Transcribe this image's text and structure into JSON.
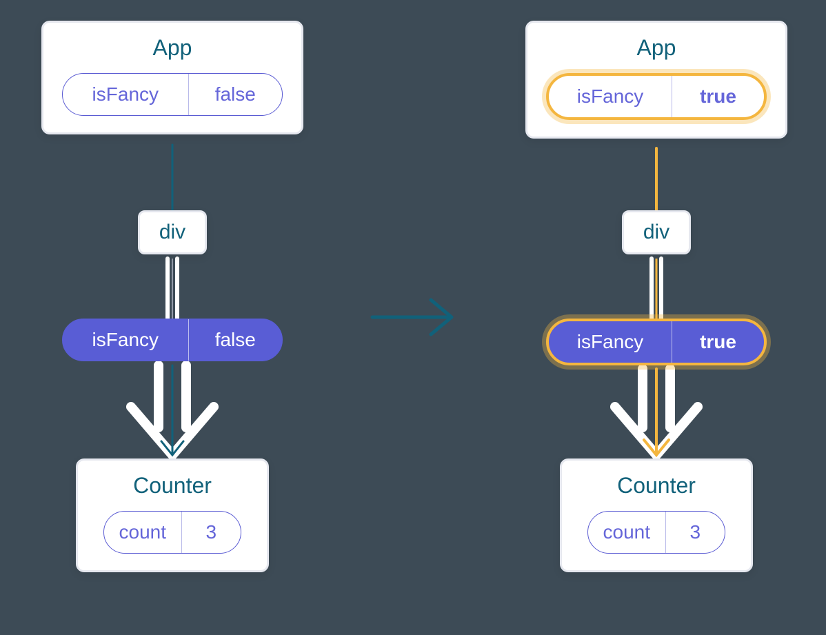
{
  "left": {
    "app": {
      "title": "App",
      "stateKey": "isFancy",
      "stateVal": "false"
    },
    "div": {
      "label": "div"
    },
    "prop": {
      "key": "isFancy",
      "val": "false"
    },
    "counter": {
      "title": "Counter",
      "stateKey": "count",
      "stateVal": "3"
    }
  },
  "right": {
    "app": {
      "title": "App",
      "stateKey": "isFancy",
      "stateVal": "true"
    },
    "div": {
      "label": "div"
    },
    "prop": {
      "key": "isFancy",
      "val": "true"
    },
    "counter": {
      "title": "Counter",
      "stateKey": "count",
      "stateVal": "3"
    }
  },
  "colors": {
    "teal": "#11617a",
    "purple": "#595dd5",
    "gold": "#f4b63f",
    "bg": "#3d4b56"
  }
}
